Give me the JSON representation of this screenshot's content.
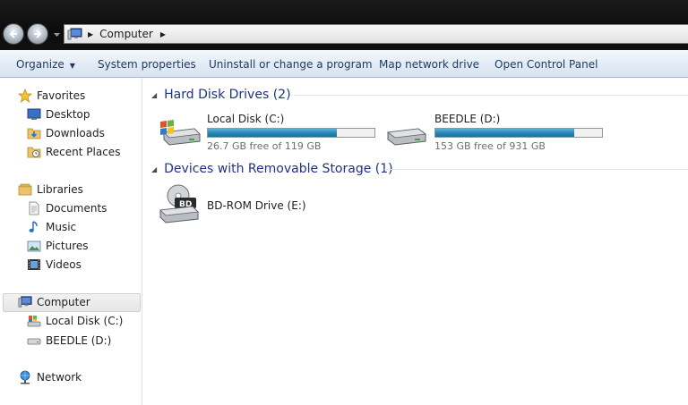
{
  "address_bar": {
    "path": [
      "Computer"
    ]
  },
  "command_bar": {
    "organize": "Organize",
    "system_properties": "System properties",
    "uninstall": "Uninstall or change a program",
    "map_drive": "Map network drive",
    "control_panel": "Open Control Panel"
  },
  "nav_pane": {
    "favorites": "Favorites",
    "desktop": "Desktop",
    "downloads": "Downloads",
    "recent_places": "Recent Places",
    "libraries": "Libraries",
    "documents": "Documents",
    "music": "Music",
    "pictures": "Pictures",
    "videos": "Videos",
    "computer": "Computer",
    "local_disk": "Local Disk (C:)",
    "beedle": "BEEDLE (D:)",
    "network": "Network"
  },
  "content": {
    "hdd_group": "Hard Disk Drives (2)",
    "removable_group": "Devices with Removable Storage (1)",
    "drives": [
      {
        "name": "Local Disk (C:)",
        "free_text": "26.7 GB free of 119 GB",
        "used_fraction": 0.776
      },
      {
        "name": "BEEDLE (D:)",
        "free_text": "153 GB free of 931 GB",
        "used_fraction": 0.836
      }
    ],
    "removable": [
      {
        "name": "BD-ROM Drive (E:)"
      }
    ]
  },
  "colors": {
    "accent_header": "#1e3287",
    "bar_fill": "#2a88b6",
    "command_text": "#1e395b"
  },
  "icons": [
    "back-arrow-icon",
    "forward-arrow-icon",
    "computer-icon",
    "star-icon",
    "folder-icon",
    "drive-icon",
    "network-icon",
    "bd-drive-icon"
  ]
}
